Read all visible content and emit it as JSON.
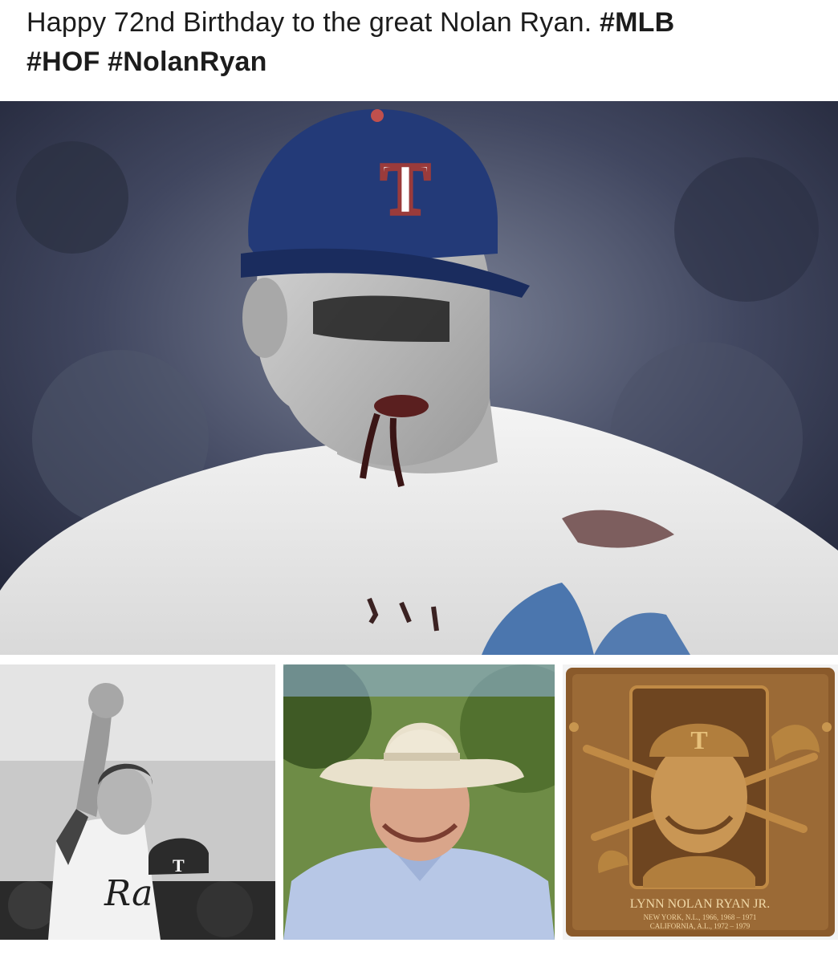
{
  "post": {
    "text_plain": "Happy 72nd Birthday to the great Nolan Ryan. ",
    "hashtags": [
      "#MLB",
      "#HOF",
      "#NolanRyan"
    ]
  },
  "hero": {
    "cap_letter": "T"
  },
  "thumbs": {
    "celebration": {
      "cap_letter": "T",
      "jersey_script": "Ra"
    },
    "cowboy": {},
    "plaque": {
      "name": "LYNN NOLAN RYAN JR.",
      "line1": "NEW YORK, N.L., 1966, 1968 – 1971",
      "line2": "CALIFORNIA, A.L., 1972 – 1979",
      "cap_letter": "T"
    }
  },
  "colors": {
    "cap_navy": "#233a78",
    "cap_logo_red": "#9a3b3b",
    "plaque_bronze": "#8a5a2b",
    "text": "#1c1c1c"
  }
}
